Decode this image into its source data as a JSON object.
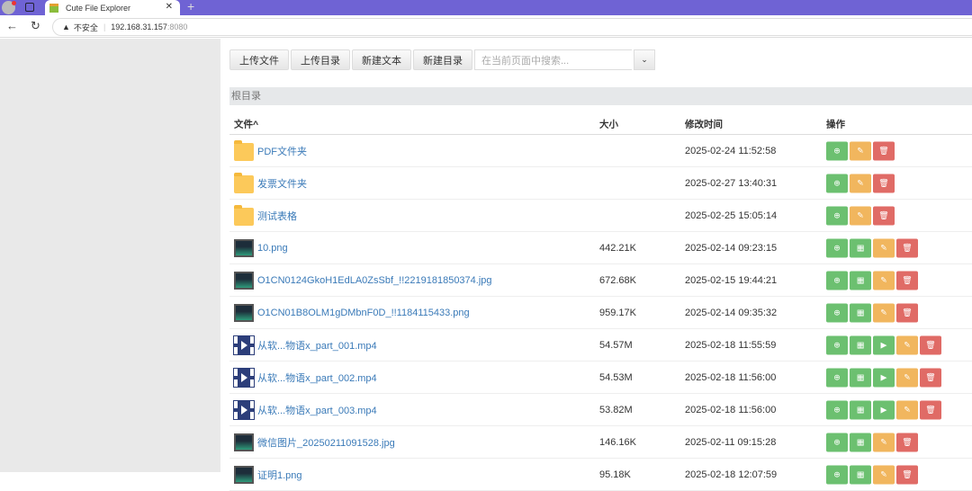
{
  "browser": {
    "tab_title": "Cute File Explorer",
    "close": "✕",
    "new_tab": "+",
    "back": "←",
    "reload": "↻",
    "security_icon": "▲",
    "security_text": "不安全",
    "url_host": "192.168.31.157",
    "url_port": ":8080"
  },
  "toolbar": {
    "upload_file": "上传文件",
    "upload_dir": "上传目录",
    "new_text": "新建文本",
    "new_dir": "新建目录",
    "search_placeholder": "在当前页面中搜索...",
    "dropdown": "⌄"
  },
  "breadcrumb": "根目录",
  "table": {
    "headers": {
      "name": "文件^",
      "size": "大小",
      "modified": "修改时间",
      "actions": "操作"
    },
    "rows": [
      {
        "type": "folder",
        "name": "PDF文件夹",
        "size": "",
        "modified": "2025-02-24 11:52:58"
      },
      {
        "type": "folder",
        "name": "发票文件夹",
        "size": "",
        "modified": "2025-02-27 13:40:31"
      },
      {
        "type": "folder",
        "name": "测试表格",
        "size": "",
        "modified": "2025-02-25 15:05:14"
      },
      {
        "type": "image",
        "name": "10.png",
        "size": "442.21K",
        "modified": "2025-02-14 09:23:15"
      },
      {
        "type": "image",
        "name": "O1CN0124GkoH1EdLA0ZsSbf_!!2219181850374.jpg",
        "size": "672.68K",
        "modified": "2025-02-15 19:44:21"
      },
      {
        "type": "image",
        "name": "O1CN01B8OLM1gDMbnF0D_!!1184115433.png",
        "size": "959.17K",
        "modified": "2025-02-14 09:35:32"
      },
      {
        "type": "video",
        "name": "从软...物语x_part_001.mp4",
        "size": "54.57M",
        "modified": "2025-02-18 11:55:59"
      },
      {
        "type": "video",
        "name": "从软...物语x_part_002.mp4",
        "size": "54.53M",
        "modified": "2025-02-18 11:56:00"
      },
      {
        "type": "video",
        "name": "从软...物语x_part_003.mp4",
        "size": "53.82M",
        "modified": "2025-02-18 11:56:00"
      },
      {
        "type": "image",
        "name": "微信图片_20250211091528.jpg",
        "size": "146.16K",
        "modified": "2025-02-11 09:15:28"
      },
      {
        "type": "image",
        "name": "证明1.png",
        "size": "95.18K",
        "modified": "2025-02-18 12:07:59"
      }
    ]
  },
  "action_icons": {
    "download": "⊕",
    "qr": "▦",
    "play": "▶",
    "rename": "✎",
    "delete": "🗑"
  },
  "colors": {
    "tabbar": "#6f63d4",
    "green": "#6cc070",
    "orange": "#f1b65e",
    "red": "#e06b66",
    "link": "#3a7ab8"
  }
}
